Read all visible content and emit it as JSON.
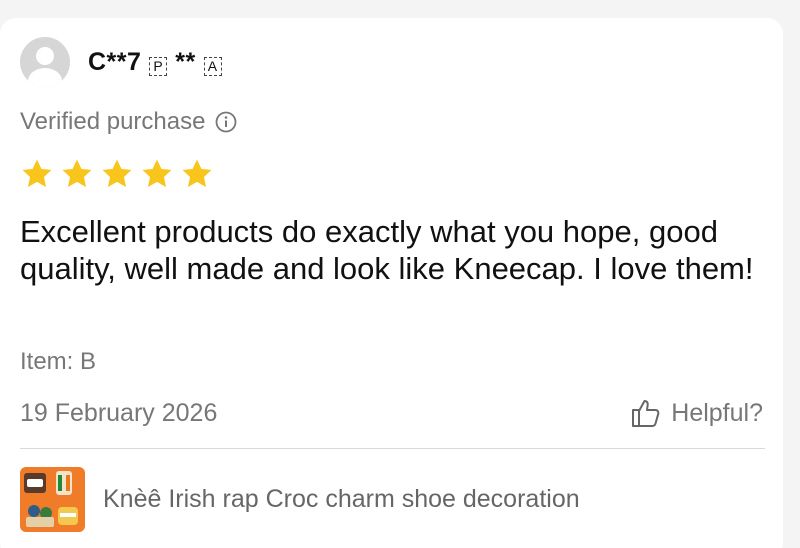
{
  "reviewer": {
    "name": "C**7",
    "country_box_1": "P",
    "name_suffix": "**",
    "country_box_2": "A",
    "avatar_icon": "user-avatar-icon"
  },
  "review": {
    "verified_label": "Verified purchase",
    "rating": 5,
    "rating_max": 5,
    "text": "Excellent products do exactly what you hope, good quality, well made and look like Kneecap. I love them!",
    "item_label": "Item: B",
    "date": "19 February 2026",
    "helpful_label": "Helpful?"
  },
  "product": {
    "title": "Knèê Irish rap Croc charm shoe decoration"
  },
  "colors": {
    "star": "#f7c51b",
    "muted_text": "#777777",
    "thumb_bg": "#f07c2a",
    "avatar_bg": "#d6d6d6"
  }
}
